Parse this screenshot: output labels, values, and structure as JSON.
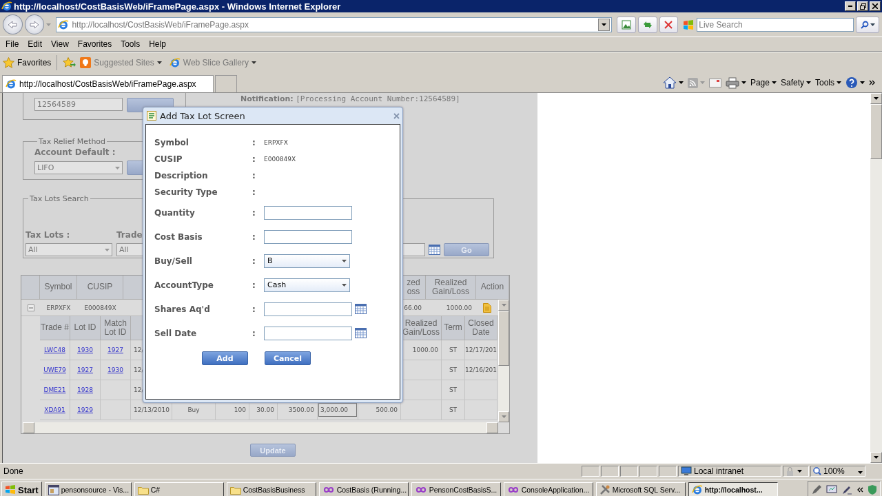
{
  "window": {
    "title": "http://localhost/CostBasisWeb/iFramePage.aspx - Windows Internet Explorer"
  },
  "nav": {
    "address": "http://localhost/CostBasisWeb/iFramePage.aspx",
    "search_placeholder": "Live Search"
  },
  "menu": [
    "File",
    "Edit",
    "View",
    "Favorites",
    "Tools",
    "Help"
  ],
  "favorites_bar": {
    "favorites": "Favorites",
    "links": [
      "Suggested Sites",
      "Web Slice Gallery"
    ]
  },
  "tabs": [
    {
      "label": "http://localhost/CostBasisWeb/iFramePage.aspx",
      "selected": true
    }
  ],
  "command_bar": [
    "Page",
    "Safety",
    "Tools"
  ],
  "page": {
    "account": "12564589",
    "notification": {
      "label": "Notification:",
      "text": "[Processing Account Number:12564589]"
    },
    "tax_relief": {
      "legend": "Tax Relief Method",
      "label": "Account Default :",
      "method": "LIFO"
    },
    "search": {
      "legend": "Tax Lots Search",
      "tax_lots_label": "Tax Lots :",
      "tax_lots": "All",
      "trade_label": "Trade",
      "trade": "All",
      "go": "Go"
    },
    "lots_table": {
      "columns": [
        "Symbol",
        "CUSIP",
        "zed oss",
        "Realized Gain/Loss",
        "Action"
      ],
      "row": {
        "expanded": true,
        "symbol": "ERPXFX",
        "cusip": "E000849X",
        "column_3": "66.00",
        "realized": "1000.00"
      }
    },
    "detail_table": {
      "columns_left": [
        "Trade #",
        "Lot ID",
        "Match Lot ID"
      ],
      "columns_right": [
        "Realized Gain/Loss",
        "Term",
        "Closed Date"
      ],
      "rows": [
        {
          "trade": "LWC48",
          "lot": "1930",
          "match": "1927",
          "date": "12/",
          "realized": "1000.00",
          "term": "ST",
          "closed": "12/17/201"
        },
        {
          "trade": "UWE79",
          "lot": "1927",
          "match": "1930",
          "date": "12/",
          "term": "ST",
          "closed": "12/16/201"
        },
        {
          "trade": "DME21",
          "lot": "1928",
          "date": "12/",
          "term": "ST"
        },
        {
          "trade": "XDA91",
          "lot": "1929",
          "date": "12/13/2010",
          "side": "Buy",
          "qty": "100",
          "price": "30.00",
          "amount": "3500.00",
          "cost": "3,000.00",
          "gain": "500.00",
          "term": "ST"
        }
      ]
    },
    "update": "Update"
  },
  "dialog": {
    "title": "Add Tax Lot Screen",
    "fields": [
      {
        "label": "Symbol",
        "colon": ":",
        "kind": "text",
        "value": "ERPXFX"
      },
      {
        "label": "CUSIP",
        "colon": ":",
        "kind": "text",
        "value": "E000849X"
      },
      {
        "label": "Description",
        "colon": ":",
        "kind": "text"
      },
      {
        "label": "Security Type",
        "colon": ":",
        "kind": "text"
      },
      {
        "label": "Quantity",
        "colon": ":",
        "kind": "input"
      },
      {
        "label": "Cost Basis",
        "colon": ":",
        "kind": "input"
      },
      {
        "label": "Buy/Sell",
        "colon": ":",
        "kind": "select",
        "value": "B"
      },
      {
        "label": "AccountType",
        "colon": ":",
        "kind": "select",
        "value": "Cash"
      },
      {
        "label": "Shares Aq'd",
        "colon": ":",
        "kind": "date"
      },
      {
        "label": "Sell Date",
        "colon": ":",
        "kind": "date"
      }
    ],
    "buttons": [
      "Add",
      "Cancel"
    ]
  },
  "status_bar": {
    "status": "Done",
    "zone": "Local intranet",
    "zoom": "100%"
  },
  "taskbar": {
    "start": "Start",
    "items": [
      {
        "label": "pensonsource - Vis...",
        "kind": "app",
        "selected": false
      },
      {
        "label": "C#",
        "kind": "folder",
        "selected": false
      },
      {
        "label": "CostBasisBusiness",
        "kind": "folder",
        "selected": false
      },
      {
        "label": "CostBasis (Running...",
        "kind": "studio",
        "selected": false
      },
      {
        "label": "PensonCostBasisS...",
        "kind": "studio",
        "selected": false
      },
      {
        "label": "ConsoleApplication...",
        "kind": "studio",
        "selected": false
      },
      {
        "label": "Microsoft SQL Serv...",
        "kind": "tool",
        "selected": false
      },
      {
        "label": "http://localhost...",
        "kind": "browser",
        "selected": true
      }
    ]
  }
}
